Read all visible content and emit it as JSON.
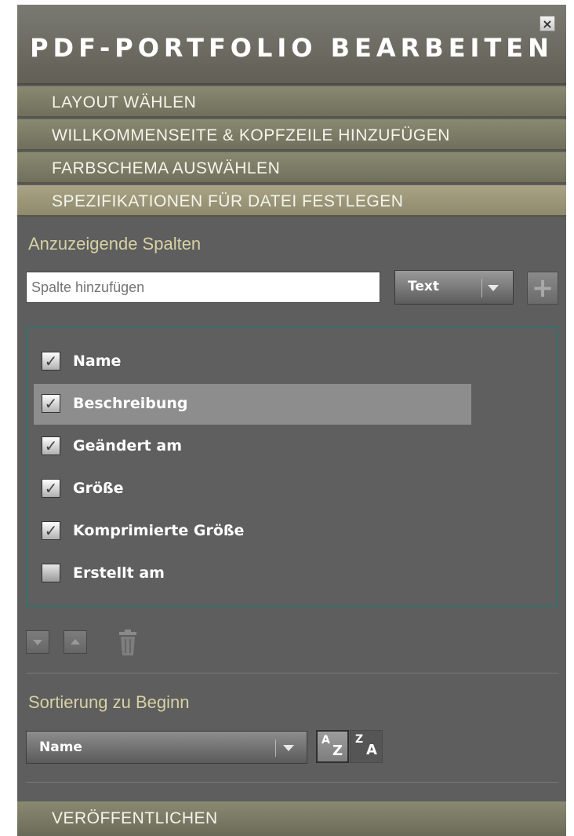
{
  "header": {
    "title": "PDF-PORTFOLIO BEARBEITEN",
    "close_glyph": "×"
  },
  "sections": [
    {
      "label": "LAYOUT WÄHLEN"
    },
    {
      "label": "WILLKOMMENSEITE & KOPFZEILE HINZUFÜGEN"
    },
    {
      "label": "FARBSCHEMA AUSWÄHLEN"
    },
    {
      "label": "SPEZIFIKATIONEN FÜR DATEI FESTLEGEN",
      "active": true
    }
  ],
  "columns_panel": {
    "heading": "Anzuzeigende Spalten",
    "add_input": {
      "value": "",
      "placeholder": "Spalte hinzufügen"
    },
    "type_select": {
      "value": "Text"
    },
    "add_button_glyph": "+",
    "items": [
      {
        "label": "Name",
        "checked": true,
        "selected": false
      },
      {
        "label": "Beschreibung",
        "checked": true,
        "selected": true
      },
      {
        "label": "Geändert am",
        "checked": true,
        "selected": false
      },
      {
        "label": "Größe",
        "checked": true,
        "selected": false
      },
      {
        "label": "Komprimierte Größe",
        "checked": true,
        "selected": false
      },
      {
        "label": "Erstellt am",
        "checked": false,
        "selected": false
      }
    ],
    "check_glyph": "✓"
  },
  "sort_panel": {
    "heading": "Sortierung zu Beginn",
    "select": {
      "value": "Name"
    },
    "ascending": {
      "top": "A",
      "bottom": "Z"
    },
    "descending": {
      "top": "Z",
      "bottom": "A"
    }
  },
  "publish": {
    "label": "VERÖFFENTLICHEN"
  },
  "colors": {
    "panel_bg": "#5e5e5e",
    "section_bar": "#7d7d68",
    "active_section_bar": "#a39d7f",
    "heading_text": "#d7d1a4",
    "list_border": "#3a6f6a",
    "selected_row": "#8d8d8d"
  }
}
